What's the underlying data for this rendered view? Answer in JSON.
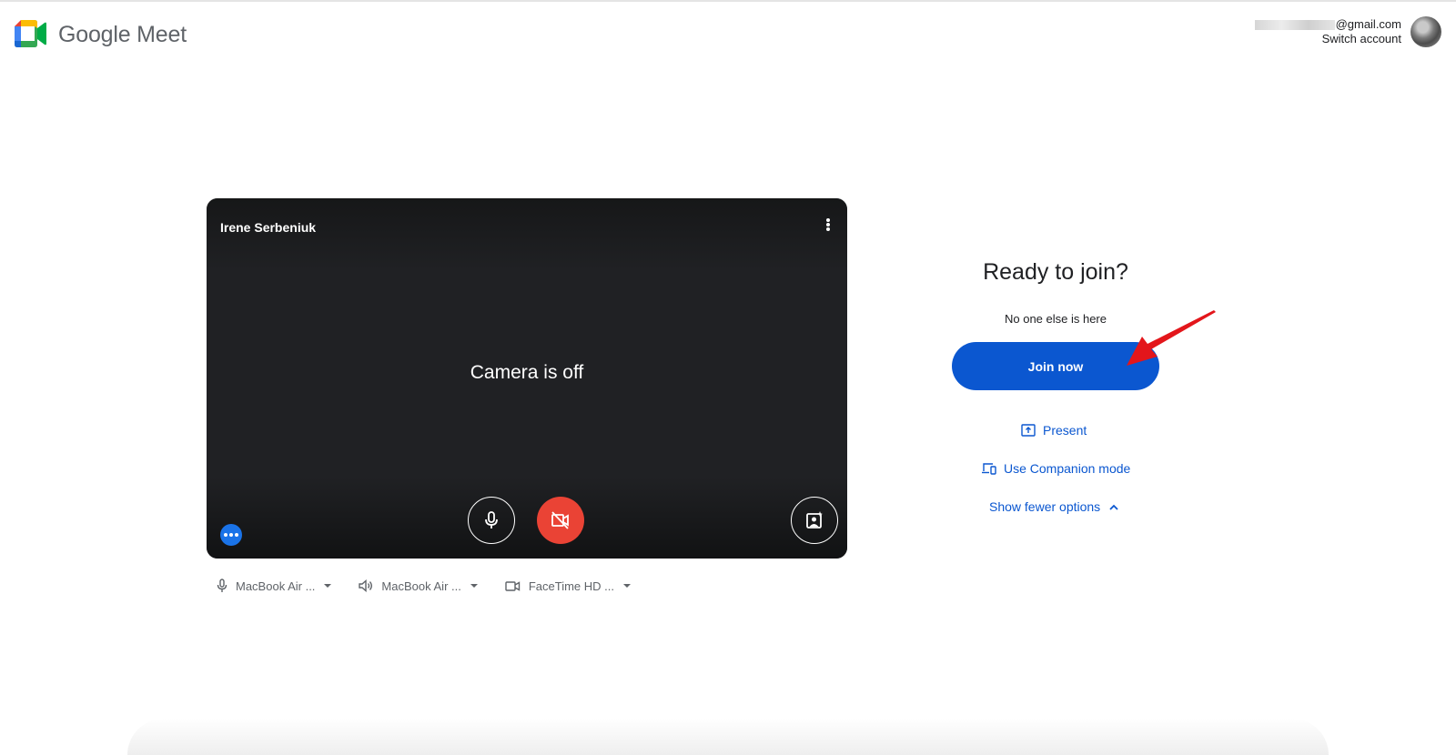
{
  "header": {
    "brand_google": "Google",
    "brand_meet": "Meet",
    "account_email_suffix": "@gmail.com",
    "switch_account": "Switch account"
  },
  "preview": {
    "participant_name": "Irene Serbeniuk",
    "camera_status": "Camera is off"
  },
  "devices": {
    "microphone": "MacBook Air ...",
    "speaker": "MacBook Air ...",
    "camera": "FaceTime HD ..."
  },
  "join_panel": {
    "title": "Ready to join?",
    "subtitle": "No one else is here",
    "join_button": "Join now",
    "present": "Present",
    "companion_mode": "Use Companion mode",
    "show_fewer": "Show fewer options"
  },
  "colors": {
    "accent": "#0b57d0",
    "camera_off": "#ea4335",
    "preview_bg": "#202124",
    "annotation_arrow": "#e3161b"
  }
}
